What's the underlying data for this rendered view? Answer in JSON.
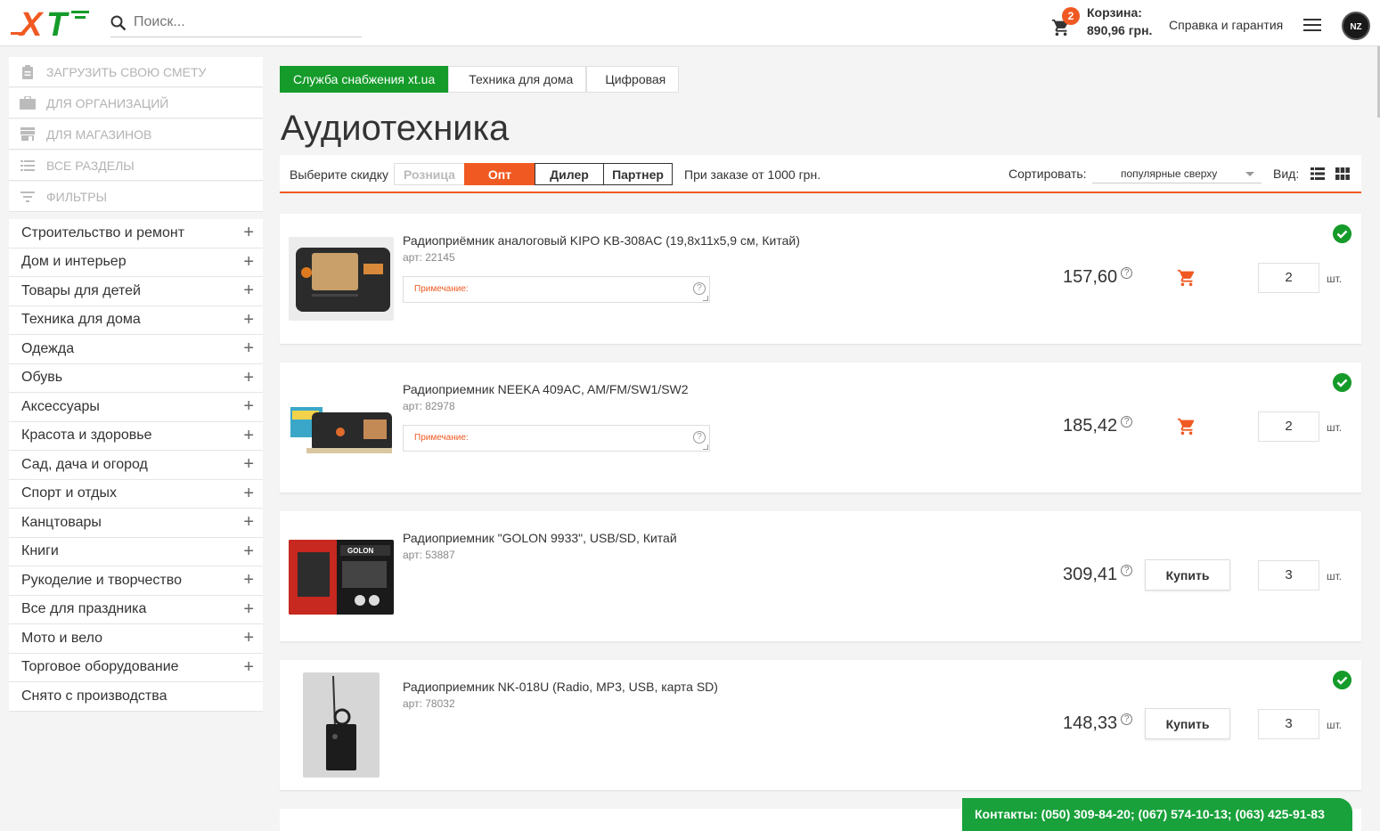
{
  "header": {
    "logo_text": "XT",
    "search_placeholder": "Поиск...",
    "cart": {
      "count": "2",
      "title": "Корзина:",
      "sum": "890,96 грн."
    },
    "help_link": "Справка и гарантия",
    "avatar_text": "NZ"
  },
  "sidebar": {
    "top_items": [
      {
        "label": "Загрузить свою смету",
        "icon": "clipboard-icon"
      },
      {
        "label": "Для организаций",
        "icon": "briefcase-icon"
      },
      {
        "label": "Для магазинов",
        "icon": "store-icon"
      },
      {
        "label": "Все разделы",
        "icon": "list-icon"
      },
      {
        "label": "Фильтры",
        "icon": "filter-icon"
      }
    ],
    "categories": [
      {
        "label": "Строительство и ремонт",
        "plus": "+"
      },
      {
        "label": "Дом и интерьер",
        "plus": "+"
      },
      {
        "label": "Товары для детей",
        "plus": "+"
      },
      {
        "label": "Техника для дома",
        "plus": "+"
      },
      {
        "label": "Одежда",
        "plus": "+"
      },
      {
        "label": "Обувь",
        "plus": "+"
      },
      {
        "label": "Аксессуары",
        "plus": "+"
      },
      {
        "label": "Красота и здоровье",
        "plus": "+"
      },
      {
        "label": "Сад, дача и огород",
        "plus": "+"
      },
      {
        "label": "Спорт и отдых",
        "plus": "+"
      },
      {
        "label": "Канцтовары",
        "plus": "+"
      },
      {
        "label": "Книги",
        "plus": "+"
      },
      {
        "label": "Рукоделие и творчество",
        "plus": "+"
      },
      {
        "label": "Все для праздника",
        "plus": "+"
      },
      {
        "label": "Мото и вело",
        "plus": "+"
      },
      {
        "label": "Торговое оборудование",
        "plus": "+"
      },
      {
        "label": "Снято с производства",
        "plus": ""
      }
    ]
  },
  "breadcrumb": [
    "Служба снабжения xt.ua",
    "Техника для дома",
    "Цифровая"
  ],
  "page_title": "Аудиотехника",
  "filters": {
    "discount_label": "Выберите скидку",
    "segments": [
      "Розница",
      "Опт",
      "Дилер",
      "Партнер"
    ],
    "active_segment": "Опт",
    "note": "При заказе от 1000 грн.",
    "sort_label": "Сортировать:",
    "sort_value": "популярные сверху",
    "view_label": "Вид:"
  },
  "products": [
    {
      "name": "Радиоприёмник аналоговый KIPO KB-308AC (19,8x11x5,9 см, Китай)",
      "sku": "арт: 22145",
      "note_placeholder": "Примечание:",
      "price": "157,60",
      "in_cart": true,
      "qty": "2",
      "unit": "шт."
    },
    {
      "name": "Радиоприемник NEEKA 409AC, AM/FM/SW1/SW2",
      "sku": "арт: 82978",
      "note_placeholder": "Примечание:",
      "price": "185,42",
      "in_cart": true,
      "qty": "2",
      "unit": "шт."
    },
    {
      "name": "Радиоприемник \"GOLON 9933\", USB/SD, Китай",
      "sku": "арт: 53887",
      "price": "309,41",
      "buy_label": "Купить",
      "in_cart": false,
      "qty": "3",
      "unit": "шт."
    },
    {
      "name": "Радиоприемник NK-018U (Radio, MP3, USB, карта SD)",
      "sku": "арт: 78032",
      "price": "148,33",
      "buy_label": "Купить",
      "in_cart": true,
      "qty": "3",
      "unit": "шт."
    }
  ],
  "image_labels": {
    "golon_brand": "GOLON"
  },
  "contact_bar": "Контакты: (050) 309-84-20; (067) 574-10-13; (063) 425-91-83",
  "colors": {
    "accent": "#f05a22",
    "green": "#159b2a"
  }
}
